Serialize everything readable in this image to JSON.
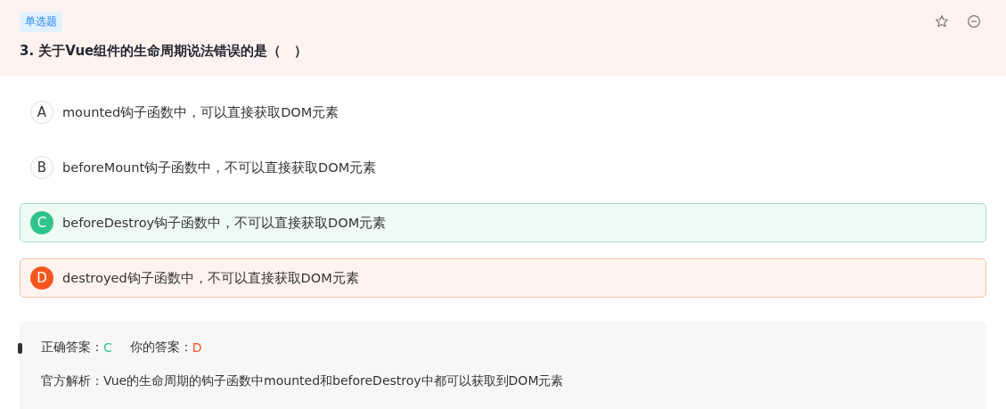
{
  "question": {
    "type_tag": "单选题",
    "title": "3. 关于Vue组件的生命周期说法错误的是（　）",
    "starred": false
  },
  "options": [
    {
      "letter": "A",
      "text": "mounted钩子函数中，可以直接获取DOM元素",
      "correct": false,
      "selected": false
    },
    {
      "letter": "B",
      "text": "beforeMount钩子函数中，不可以直接获取DOM元素",
      "correct": false,
      "selected": false
    },
    {
      "letter": "C",
      "text": "beforeDestroy钩子函数中，不可以直接获取DOM元素",
      "correct": true,
      "selected": false
    },
    {
      "letter": "D",
      "text": "destroyed钩子函数中，不可以直接获取DOM元素",
      "correct": false,
      "selected": true
    }
  ],
  "result": {
    "correct_label": "正确答案：",
    "correct_value": "C",
    "yours_label": "你的答案：",
    "yours_value": "D",
    "analysis": "官方解析：Vue的生命周期的钩子函数中mounted和beforeDestroy中都可以获取到DOM元素"
  }
}
